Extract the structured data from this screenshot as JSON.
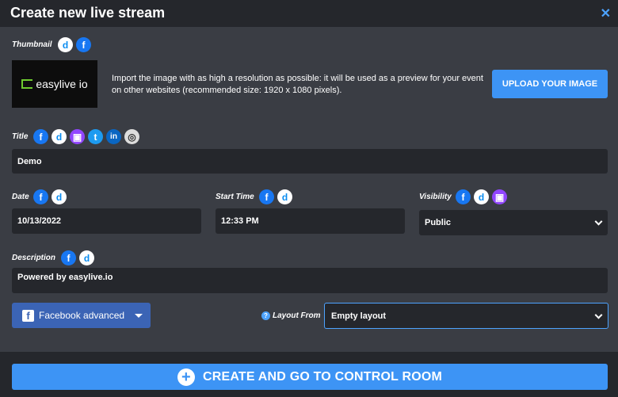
{
  "header": {
    "title": "Create new live stream",
    "close_label": "✕"
  },
  "thumbnail": {
    "label": "Thumbnail",
    "logo_text": "easylive io",
    "import_text": "Import the image with as high a resolution as possible: it will be used as a preview for your event on other websites (recommended size: 1920 x 1080 pixels).",
    "upload_label": "UPLOAD YOUR IMAGE"
  },
  "title_field": {
    "label": "Title",
    "value": "Demo"
  },
  "date_field": {
    "label": "Date",
    "value": "10/13/2022"
  },
  "start_time_field": {
    "label": "Start Time",
    "value": "12:33 PM"
  },
  "visibility_field": {
    "label": "Visibility",
    "value": "Public"
  },
  "description_field": {
    "label": "Description",
    "value": "Powered by easylive.io"
  },
  "facebook_advanced": {
    "label": "Facebook advanced"
  },
  "layout_from": {
    "label": "Layout From",
    "value": "Empty layout"
  },
  "footer": {
    "create_label": "CREATE AND GO TO CONTROL ROOM"
  },
  "icons": {
    "facebook": "f",
    "dlive": "d",
    "twitch": "▣",
    "twitter": "t",
    "linkedin": "in",
    "other": "◎"
  },
  "colors": {
    "accent": "#3d94f5",
    "facebook_button": "#3b64b5"
  }
}
